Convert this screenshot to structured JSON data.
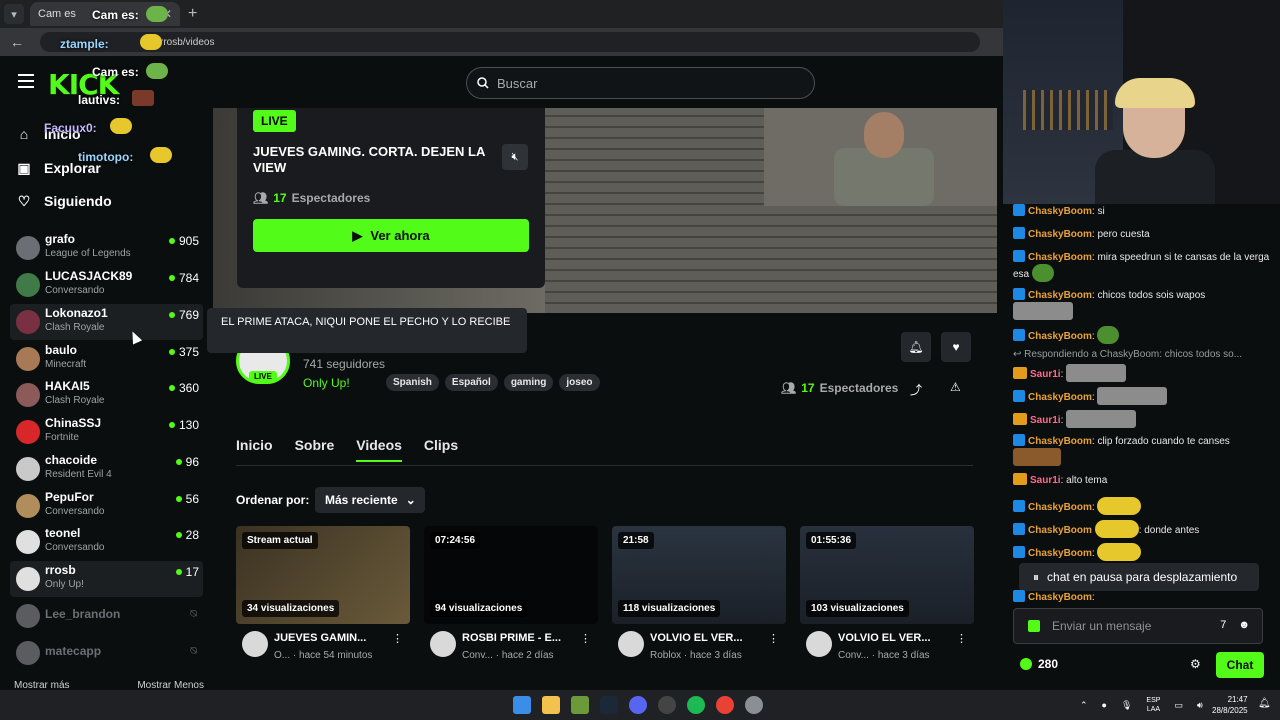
{
  "browser": {
    "tab_title": "Cam es",
    "address": "rrosb/videos"
  },
  "site": {
    "logo": "KICK",
    "search_placeholder": "Buscar"
  },
  "sidebar": {
    "nav": [
      {
        "label": "Inicio",
        "icon": "home-icon"
      },
      {
        "label": "Explorar",
        "icon": "compass-icon"
      },
      {
        "label": "Siguiendo",
        "icon": "heart-icon"
      }
    ],
    "following": [
      {
        "name": "grafo",
        "category": "League of Legends",
        "viewers": "905",
        "live": true
      },
      {
        "name": "LUCASJACK89",
        "category": "Conversando",
        "viewers": "784",
        "live": true
      },
      {
        "name": "Lokonazo1",
        "category": "Clash Royale",
        "viewers": "769",
        "live": true
      },
      {
        "name": "baulo",
        "category": "Minecraft",
        "viewers": "375",
        "live": true
      },
      {
        "name": "HAKAI5",
        "category": "Clash Royale",
        "viewers": "360",
        "live": true
      },
      {
        "name": "ChinaSSJ",
        "category": "Fortnite",
        "viewers": "130",
        "live": true
      },
      {
        "name": "chacoide",
        "category": "Resident Evil 4",
        "viewers": "96",
        "live": true
      },
      {
        "name": "PepuFor",
        "category": "Conversando",
        "viewers": "56",
        "live": true
      },
      {
        "name": "teonel",
        "category": "Conversando",
        "viewers": "28",
        "live": true
      },
      {
        "name": "rrosb",
        "category": "Only Up!",
        "viewers": "17",
        "live": true
      },
      {
        "name": "Lee_brandon",
        "category": "",
        "viewers": "",
        "live": false
      },
      {
        "name": "matecapp",
        "category": "",
        "viewers": "",
        "live": false
      }
    ],
    "show_more": "Mostrar más",
    "show_less": "Mostrar Menos"
  },
  "tooltip": "EL PRIME ATACA, NIQUI PONE EL PECHO Y LO RECIBE",
  "live_card": {
    "badge": "LIVE",
    "title": "JUEVES GAMING. CORTA. DEJEN LA VIEW",
    "viewers_num": "17",
    "viewers_label": "Espectadores",
    "watch_label": "Ver ahora"
  },
  "channel": {
    "followers": "741 seguidores",
    "live_badge": "LIVE",
    "category": "Only Up!",
    "tags": [
      "Spanish",
      "Español",
      "gaming",
      "joseo"
    ],
    "viewers_num": "17",
    "viewers_label": "Espectadores",
    "tabs": [
      "Inicio",
      "Sobre",
      "Videos",
      "Clips"
    ],
    "active_tab": "Videos",
    "sort_label": "Ordenar por:",
    "sort_value": "Más reciente"
  },
  "videos": [
    {
      "badge": "Stream actual",
      "views": "34 visualizaciones",
      "title": "JUEVES GAMIN...",
      "category": "O...",
      "time": "hace 54 minutos"
    },
    {
      "badge": "07:24:56",
      "views": "94 visualizaciones",
      "title": "ROSBI PRIME - E...",
      "category": "Conv...",
      "time": "hace 2 días"
    },
    {
      "badge": "21:58",
      "views": "118 visualizaciones",
      "title": "VOLVIO EL VER...",
      "category": "Roblox",
      "time": "hace 3 días"
    },
    {
      "badge": "01:55:36",
      "views": "103 visualizaciones",
      "title": "VOLVIO EL VER...",
      "category": "Conv...",
      "time": "hace 3 días"
    }
  ],
  "chat": {
    "messages": [
      {
        "user": "ChaskyBoom",
        "text": ": si"
      },
      {
        "user": "ChaskyBoom",
        "text": ": pero cuesta"
      },
      {
        "user": "ChaskyBoom",
        "text": ": mira speedrun si te cansas de la verga esa"
      },
      {
        "user": "ChaskyBoom",
        "text": ": chicos todos sois wapos"
      },
      {
        "user": "ChaskyBoom",
        "text": ":"
      },
      {
        "user": "Saur1i",
        "text": ":"
      },
      {
        "user": "ChaskyBoom",
        "text": ":"
      },
      {
        "user": "Saur1i",
        "text": ":"
      },
      {
        "user": "ChaskyBoom",
        "text": ": clip forzado cuando te canses"
      },
      {
        "user": "Saur1i",
        "text": ": alto tema"
      },
      {
        "user": "ChaskyBoom",
        "text": ":"
      },
      {
        "user": "ChaskyBoom",
        "text": ": donde antes"
      },
      {
        "user": "ChaskyBoom",
        "text": ":"
      },
      {
        "user": "ChaskyBoom",
        "text": ":"
      }
    ],
    "reply_note": "Respondiendo a ChaskyBoom: chicos todos so...",
    "pause_text": "chat en pausa para desplazamiento",
    "input_placeholder": "Enviar un mensaje",
    "points": "280",
    "send_label": "Chat"
  },
  "overlay": [
    {
      "user": "Cam es:"
    },
    {
      "user": "ztample:"
    },
    {
      "user": "Cam es:"
    },
    {
      "user": "lautivs:"
    },
    {
      "user": "Facuux0:"
    },
    {
      "user": "timotopo:"
    }
  ],
  "taskbar": {
    "lang_top": "ESP",
    "lang_bottom": "LAA",
    "time": "21:47",
    "date": "28/8/2025"
  },
  "colors": {
    "accent": "#53fc18",
    "background": "#0b0e0f",
    "panel": "#191b1f"
  }
}
